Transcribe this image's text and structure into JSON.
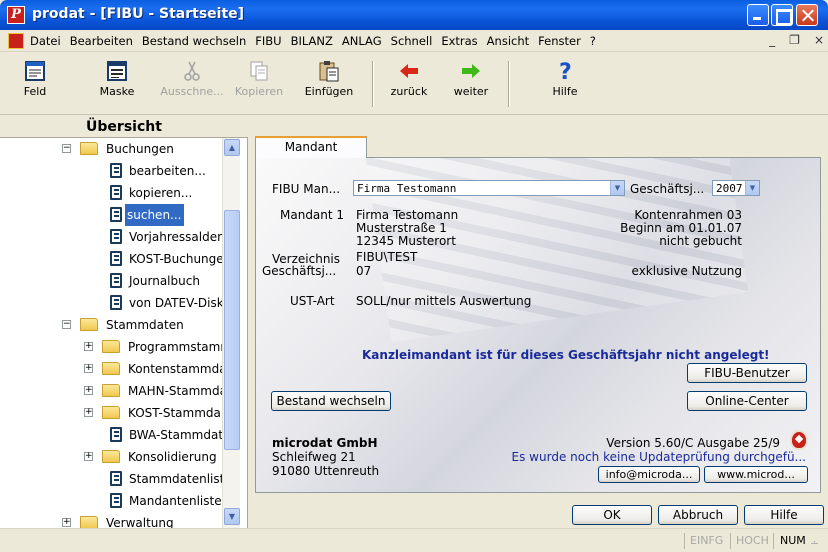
{
  "window": {
    "title": "prodat - [FIBU - Startseite]"
  },
  "menu": [
    "Datei",
    "Bearbeiten",
    "Bestand wechseln",
    "FIBU",
    "BILANZ",
    "ANLAG",
    "Schnell",
    "Extras",
    "Ansicht",
    "Fenster",
    "?"
  ],
  "menu_right": {
    "minimize": "_",
    "restore": "̅❐",
    "close": "×"
  },
  "toolbar": [
    {
      "label": "Feld",
      "icon": "field-icon",
      "enabled": true
    },
    {
      "label": "Maske",
      "icon": "mask-icon",
      "enabled": true
    },
    {
      "label": "Ausschne...",
      "icon": "scissors-icon",
      "enabled": false
    },
    {
      "label": "Kopieren",
      "icon": "copy-icon",
      "enabled": false
    },
    {
      "label": "Einfügen",
      "icon": "paste-icon",
      "enabled": true
    },
    {
      "label": "zurück",
      "icon": "arrow-left-icon",
      "enabled": true
    },
    {
      "label": "weiter",
      "icon": "arrow-right-icon",
      "enabled": true
    },
    {
      "label": "Hilfe",
      "icon": "help-icon",
      "enabled": true
    }
  ],
  "sidebar": {
    "title": "Übersicht",
    "tree": [
      {
        "label": "Buchungen",
        "type": "folder",
        "exp": "−"
      },
      {
        "label": "bearbeiten...",
        "type": "doc"
      },
      {
        "label": "kopieren...",
        "type": "doc"
      },
      {
        "label": "suchen...",
        "type": "doc",
        "selected": true
      },
      {
        "label": "Vorjahressalden",
        "type": "doc"
      },
      {
        "label": "KOST-Buchunge",
        "type": "doc"
      },
      {
        "label": "Journalbuch",
        "type": "doc"
      },
      {
        "label": "von DATEV-Disk",
        "type": "doc"
      },
      {
        "label": "Stammdaten",
        "type": "folder",
        "exp": "−"
      },
      {
        "label": "Programmstamn",
        "type": "folder",
        "exp": "+"
      },
      {
        "label": "Kontenstammda",
        "type": "folder",
        "exp": "+"
      },
      {
        "label": "MAHN-Stammda",
        "type": "folder",
        "exp": "+"
      },
      {
        "label": "KOST-Stammda",
        "type": "folder",
        "exp": "+"
      },
      {
        "label": "BWA-Stammdat",
        "type": "doc"
      },
      {
        "label": "Konsolidierung",
        "type": "folder",
        "exp": "+"
      },
      {
        "label": "Stammdatenliste",
        "type": "doc"
      },
      {
        "label": "Mandantenliste",
        "type": "doc"
      },
      {
        "label": "Verwaltung",
        "type": "folder",
        "exp": "+"
      }
    ]
  },
  "tab": {
    "label": "Mandant"
  },
  "form": {
    "fibu_label": "FIBU Man...",
    "fibu_value": "Firma Testomann",
    "gj_label": "Geschäftsj...",
    "gj_value": "2007",
    "mandant_label": "Mandant 1",
    "mandant_lines": [
      "Firma Testomann",
      "Musterstraße 1",
      "12345 Musterort"
    ],
    "right_lines": [
      "Kontenrahmen 03",
      "Beginn am 01.01.07",
      "nicht gebucht"
    ],
    "verz_label": "Verzeichnis",
    "verz_value": "FIBU\\TEST",
    "gj2_label": "Geschäftsj...",
    "gj2_value": "07",
    "exklusiv": "exklusive Nutzung",
    "ust_label": "UST-Art",
    "ust_value": "SOLL/nur mittels Auswertung",
    "warning": "Kanzleimandant ist für dieses Geschäftsjahr nicht angelegt!",
    "fibu_benutzer": "FIBU-Benutzer",
    "bestand": "Bestand wechseln",
    "online": "Online-Center"
  },
  "company": {
    "name": "microdat GmbH",
    "street": "Schleifweg 21",
    "city": "91080 Uttenreuth",
    "version": "Version 5.60/C Ausgabe 25/9",
    "update": "Es wurde noch keine Updateprüfung durchgefü...",
    "email": "info@microda...",
    "web": "www.microd..."
  },
  "buttons": {
    "ok": "OK",
    "cancel": "Abbruch",
    "help": "Hilfe"
  },
  "status": [
    "EINFG",
    "HOCH",
    "NUM"
  ]
}
